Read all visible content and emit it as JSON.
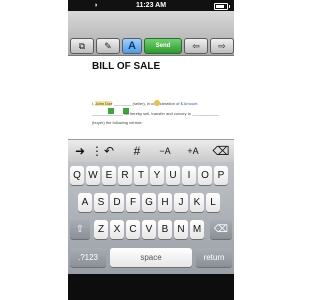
{
  "status_bar": {
    "time": "11:23 AM",
    "wifi_icon": "wifi-icon",
    "battery_icon": "battery-icon"
  },
  "toolbar": {
    "buttons": [
      {
        "name": "document-icon",
        "glyph": "⧉"
      },
      {
        "name": "pen-icon",
        "glyph": "✎"
      },
      {
        "name": "font-icon",
        "label": "A"
      },
      {
        "name": "send-button",
        "label": "Send"
      },
      {
        "name": "prev-page-icon",
        "glyph": "⇦"
      },
      {
        "name": "next-page-icon",
        "glyph": "⇨"
      }
    ]
  },
  "document": {
    "title": "BILL OF SALE",
    "line1_prefix": "I,",
    "line1_name": "John Doe",
    "line1_rest": "(seller), in consideration of",
    "line1_blue": "$ Amount",
    "line2": "do hereby sell, transfer and convey to",
    "line3": "(buyer) the following vehicle:"
  },
  "formatbar": {
    "items": [
      {
        "name": "tab-icon",
        "glyph": "➜"
      },
      {
        "name": "separator-icon",
        "glyph": "⋮"
      },
      {
        "name": "undo-icon",
        "glyph": "↶"
      },
      {
        "name": "hash-icon",
        "glyph": "#"
      },
      {
        "name": "decrease-font-icon",
        "glyph": "−A"
      },
      {
        "name": "increase-font-icon",
        "glyph": "+A"
      },
      {
        "name": "eraser-icon",
        "glyph": "⌫"
      }
    ]
  },
  "keyboard": {
    "row1": [
      "Q",
      "W",
      "E",
      "R",
      "T",
      "Y",
      "U",
      "I",
      "O",
      "P"
    ],
    "row2": [
      "A",
      "S",
      "D",
      "F",
      "G",
      "H",
      "J",
      "K",
      "L"
    ],
    "row3": [
      "Z",
      "X",
      "C",
      "V",
      "B",
      "N",
      "M"
    ],
    "shift_icon": "shift-icon",
    "backspace_icon": "backspace-icon",
    "mode_key": ".?123",
    "space_key": "space",
    "return_key": "return"
  }
}
